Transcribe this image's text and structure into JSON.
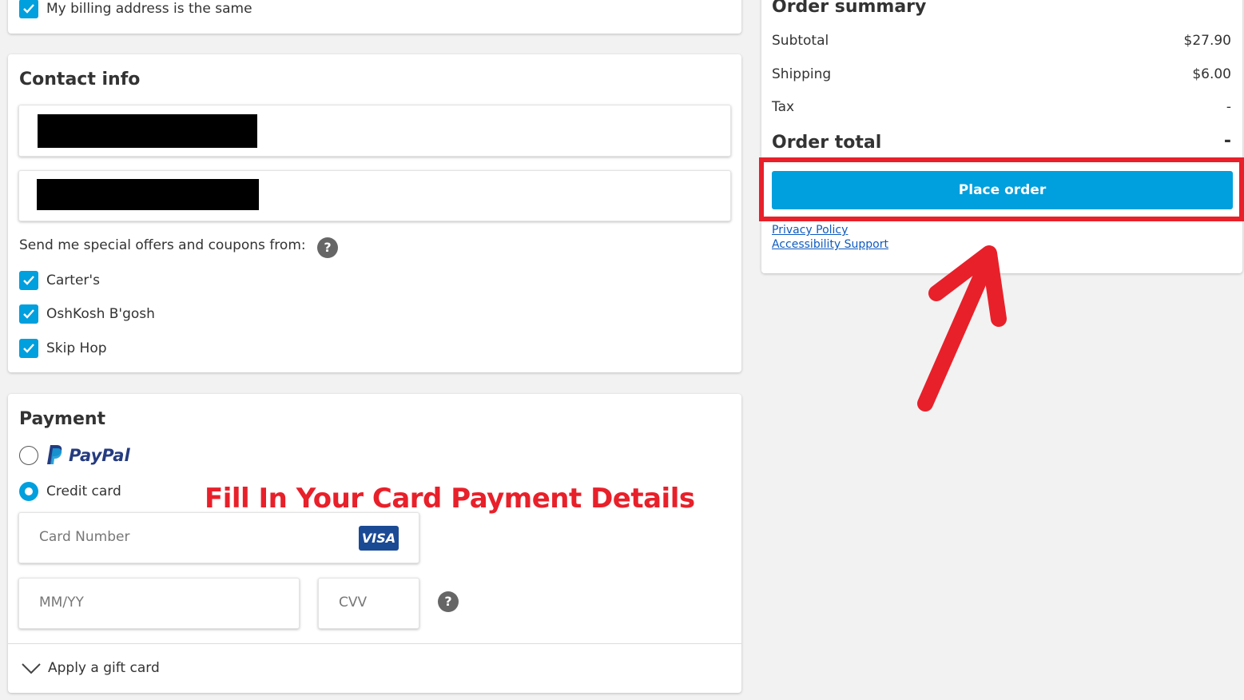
{
  "billing": {
    "same_label": "My billing address is the same"
  },
  "contact": {
    "title": "Contact info",
    "offers_label": "Send me special offers and coupons from:",
    "brands": [
      {
        "label": "Carter's"
      },
      {
        "label": "OshKosh B'gosh"
      },
      {
        "label": "Skip Hop"
      }
    ]
  },
  "payment": {
    "title": "Payment",
    "paypal_label": "PayPal",
    "credit_label": "Credit card",
    "card_number_placeholder": "Card Number",
    "card_brand": "VISA",
    "expiry_placeholder": "MM/YY",
    "cvv_placeholder": "CVV",
    "gift_card_label": "Apply a gift card"
  },
  "annotation": {
    "instruction": "Fill In Your Card Payment Details",
    "highlight_color": "#e8202a"
  },
  "summary": {
    "title": "Order summary",
    "rows": [
      {
        "label": "Subtotal",
        "value": "$27.90"
      },
      {
        "label": "Shipping",
        "value": "$6.00"
      },
      {
        "label": "Tax",
        "value": "-"
      }
    ],
    "total_label": "Order total",
    "total_value": "-",
    "place_order_label": "Place order",
    "links": [
      {
        "label": "Privacy Policy"
      },
      {
        "label": "Accessibility Support"
      }
    ]
  },
  "colors": {
    "accent": "#009fdd",
    "paypal_dark": "#253b80",
    "paypal_light": "#179bd7",
    "visa": "#1a4a94"
  }
}
